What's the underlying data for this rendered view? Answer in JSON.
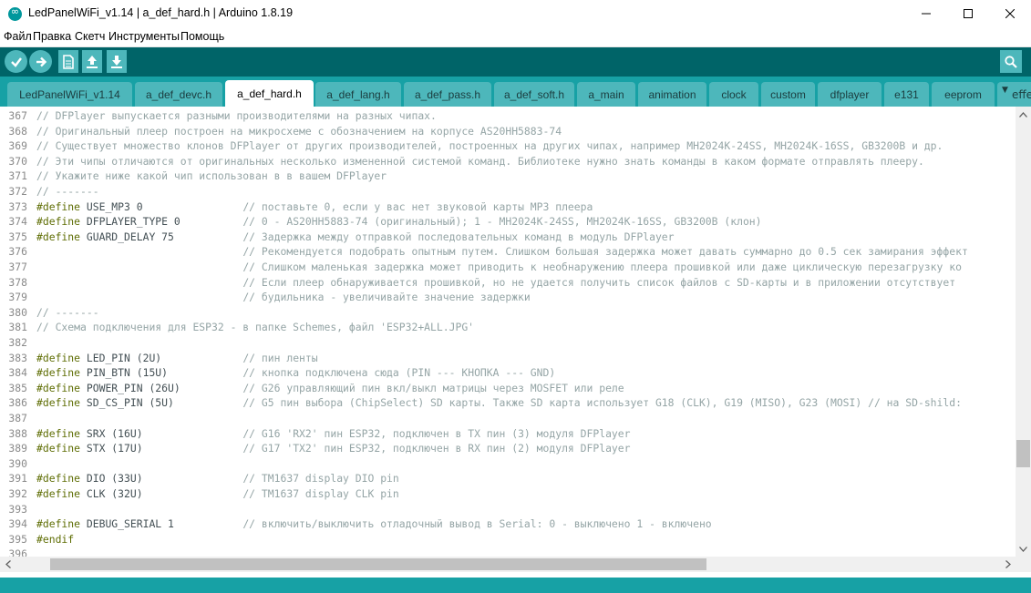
{
  "window": {
    "title": "LedPanelWiFi_v1.14 | a_def_hard.h | Arduino 1.8.19",
    "minimize_icon": "minimize-icon",
    "maximize_icon": "maximize-icon",
    "close_icon": "close-icon"
  },
  "menu": {
    "items": [
      "Файл",
      "Правка",
      "Скетч",
      "Инструменты",
      "Помощь"
    ]
  },
  "toolbar": {
    "icons": [
      "verify-icon",
      "upload-icon",
      "new-sketch-icon",
      "open-icon",
      "save-icon",
      "serial-monitor-icon"
    ]
  },
  "tabs": {
    "items": [
      "LedPanelWiFi_v1.14",
      "a_def_devc.h",
      "a_def_hard.h",
      "a_def_lang.h",
      "a_def_pass.h",
      "a_def_soft.h",
      "a_main",
      "animation",
      "clock",
      "custom",
      "dfplayer",
      "e131",
      "eeprom"
    ],
    "active": "a_def_hard.h",
    "overflow_label": "effects"
  },
  "colors": {
    "toolbar_bg": "#006468",
    "tabbar_bg": "#17a1a5",
    "tab_bg": "#4db7bb",
    "keyword": "#5e6d03",
    "comment": "#95a5a6"
  },
  "editor": {
    "lines": [
      {
        "num": "367",
        "kw": "",
        "code": "",
        "comment": "// DFPlayer выпускается разными производителями на разных чипах."
      },
      {
        "num": "368",
        "kw": "",
        "code": "",
        "comment": "// Оригинальный плеер построен на микросхеме с обозначением на корпусе AS20HH5883-74"
      },
      {
        "num": "369",
        "kw": "",
        "code": "",
        "comment": "// Существует множество клонов DFPlayer от других производителей, построенных на других чипах, например MH2024K-24SS, MH2024K-16SS, GB3200B и др."
      },
      {
        "num": "370",
        "kw": "",
        "code": "",
        "comment": "// Эти чипы отличаются от оригинальных несколько измененной системой команд. Библиотеке нужно знать команды в каком формате отправлять плееру."
      },
      {
        "num": "371",
        "kw": "",
        "code": "",
        "comment": "// Укажите ниже какой чип использован в в вашем DFPlayer"
      },
      {
        "num": "372",
        "kw": "",
        "code": "",
        "comment": "// -------"
      },
      {
        "num": "373",
        "kw": "#define",
        "code": " USE_MP3 0                ",
        "comment": "// поставьте 0, если у вас нет звуковой карты MP3 плеера"
      },
      {
        "num": "374",
        "kw": "#define",
        "code": " DFPLAYER_TYPE 0          ",
        "comment": "// 0 - AS20HH5883-74 (оригинальный); 1 - MH2024K-24SS, MH2024K-16SS, GB3200B (клон)"
      },
      {
        "num": "375",
        "kw": "#define",
        "code": " GUARD_DELAY 75           ",
        "comment": "// Задержка между отправкой последовательных команд в модуль DFPlayer"
      },
      {
        "num": "376",
        "kw": "",
        "code": "                                 ",
        "comment": "// Рекомендуется подобрать опытным путем. Слишком большая задержка может давать суммарно до 0.5 сек замирания эффект"
      },
      {
        "num": "377",
        "kw": "",
        "code": "                                 ",
        "comment": "// Слишком маленькая задержка может приводить к необнаружению плеера прошивкой или даже циклическую перезагрузку ко"
      },
      {
        "num": "378",
        "kw": "",
        "code": "                                 ",
        "comment": "// Если плеер обнаруживается прошивкой, но не удается получить список файлов с SD-карты и в приложении отсутствует"
      },
      {
        "num": "379",
        "kw": "",
        "code": "                                 ",
        "comment": "// будильника - увеличивайте значение задержки"
      },
      {
        "num": "380",
        "kw": "",
        "code": "",
        "comment": "// -------"
      },
      {
        "num": "381",
        "kw": "",
        "code": "",
        "comment": "// Схема подключения для ESP32 - в папке Schemes, файл 'ESP32+ALL.JPG'"
      },
      {
        "num": "382",
        "kw": "",
        "code": "",
        "comment": ""
      },
      {
        "num": "383",
        "kw": "#define",
        "code": " LED_PIN (2U)             ",
        "comment": "// пин ленты"
      },
      {
        "num": "384",
        "kw": "#define",
        "code": " PIN_BTN (15U)            ",
        "comment": "// кнопка подключена сюда (PIN --- КНОПКА --- GND)"
      },
      {
        "num": "385",
        "kw": "#define",
        "code": " POWER_PIN (26U)          ",
        "comment": "// G26 управляющий пин вкл/выкл матрицы через MOSFET или реле"
      },
      {
        "num": "386",
        "kw": "#define",
        "code": " SD_CS_PIN (5U)           ",
        "comment": "// G5 пин выбора (ChipSelect) SD карты. Также SD карта использует G18 (CLK), G19 (MISO), G23 (MOSI) // на SD-shild:"
      },
      {
        "num": "387",
        "kw": "",
        "code": "",
        "comment": ""
      },
      {
        "num": "388",
        "kw": "#define",
        "code": " SRX (16U)                ",
        "comment": "// G16 'RX2' пин ESP32, подключен в TX пин (3) модуля DFPlayer"
      },
      {
        "num": "389",
        "kw": "#define",
        "code": " STX (17U)                ",
        "comment": "// G17 'TX2' пин ESP32, подключен в RX пин (2) модуля DFPlayer"
      },
      {
        "num": "390",
        "kw": "",
        "code": "",
        "comment": ""
      },
      {
        "num": "391",
        "kw": "#define",
        "code": " DIO (33U)                ",
        "comment": "// TM1637 display DIO pin"
      },
      {
        "num": "392",
        "kw": "#define",
        "code": " CLK (32U)                ",
        "comment": "// TM1637 display CLK pin"
      },
      {
        "num": "393",
        "kw": "",
        "code": "",
        "comment": ""
      },
      {
        "num": "394",
        "kw": "#define",
        "code": " DEBUG_SERIAL 1           ",
        "comment": "// включить/выключить отладочный вывод в Serial: 0 - выключено 1 - включено"
      },
      {
        "num": "395",
        "kw": "#endif",
        "code": "",
        "comment": ""
      },
      {
        "num": "396",
        "kw": "",
        "code": "",
        "comment": ""
      }
    ]
  }
}
